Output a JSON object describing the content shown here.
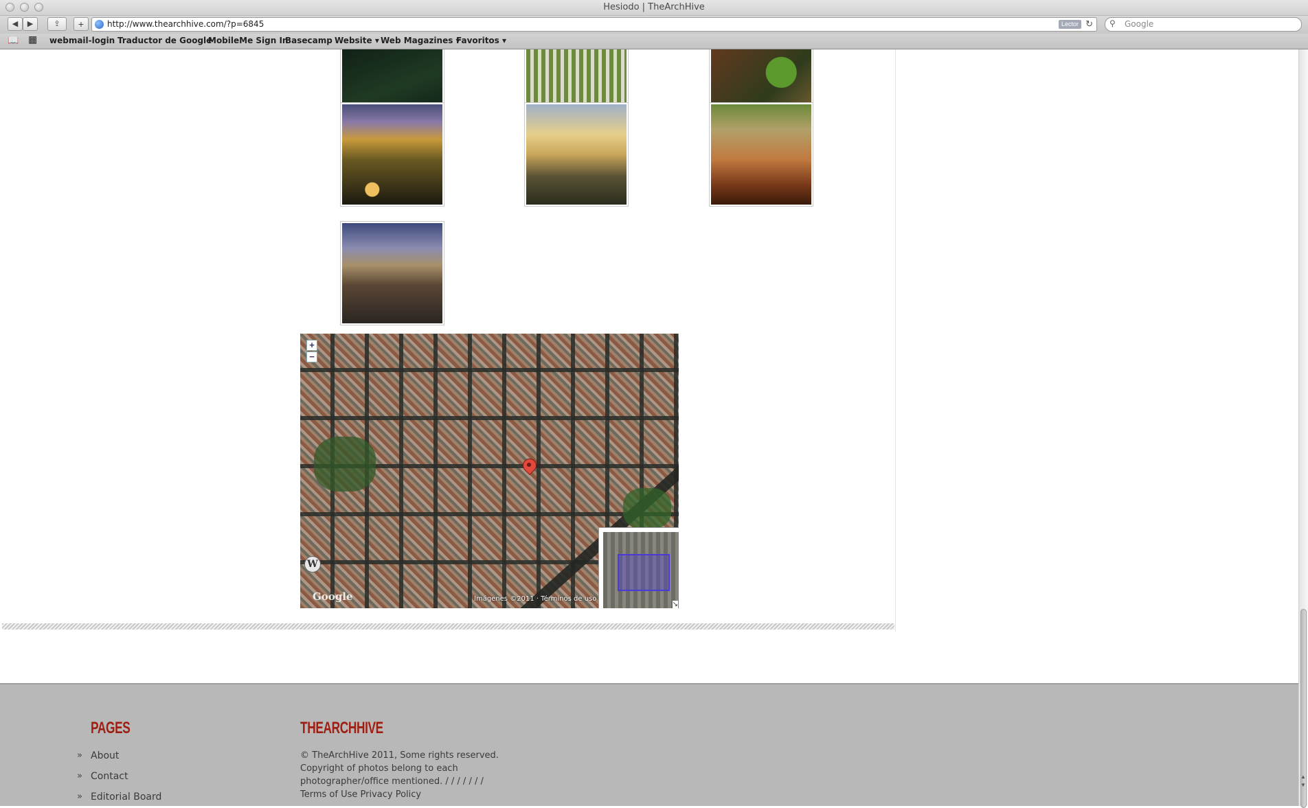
{
  "window": {
    "title": "Hesiodo | TheArchHive"
  },
  "toolbar": {
    "back_icon": "◀",
    "forward_icon": "▶",
    "share_icon": "⇪",
    "add_icon": "+",
    "url": "http://www.thearchhive.com/?p=6845",
    "reader_label": "Lector",
    "reload_icon": "↻",
    "search_placeholder": "Google",
    "search_icon": "⚲"
  },
  "bookmarks": {
    "reading_list_icon": "📖",
    "grid_icon": "▦",
    "items": [
      "webmail-login",
      "Traductor de Google",
      "MobileMe Sign In",
      "Basecamp",
      "Website ▾",
      "Web Magazines ▾",
      "Favoritos ▾"
    ]
  },
  "map": {
    "zoom_in": "+",
    "zoom_out": "−",
    "credit": "Imágenes ©2011 · Términos de uso",
    "google_logo": "Google",
    "wp_icon": "W",
    "expand_icon": "↘"
  },
  "footer": {
    "pages_heading": "PAGES",
    "pages_arrow": "»",
    "pages_items": [
      "About",
      "Contact",
      "Editorial Board"
    ],
    "site_heading": "THEARCHHIVE",
    "site_lines": [
      "© TheArchHive 2011, Some rights reserved.",
      "Copyright of photos belong to each",
      "photographer/office mentioned. / / / / / / /",
      "Terms of Use Privacy Policy"
    ]
  },
  "colors": {
    "footer_bg": "#b8b8b8",
    "footer_heading": "#9e1f12",
    "map_pin": "#e2493b"
  }
}
